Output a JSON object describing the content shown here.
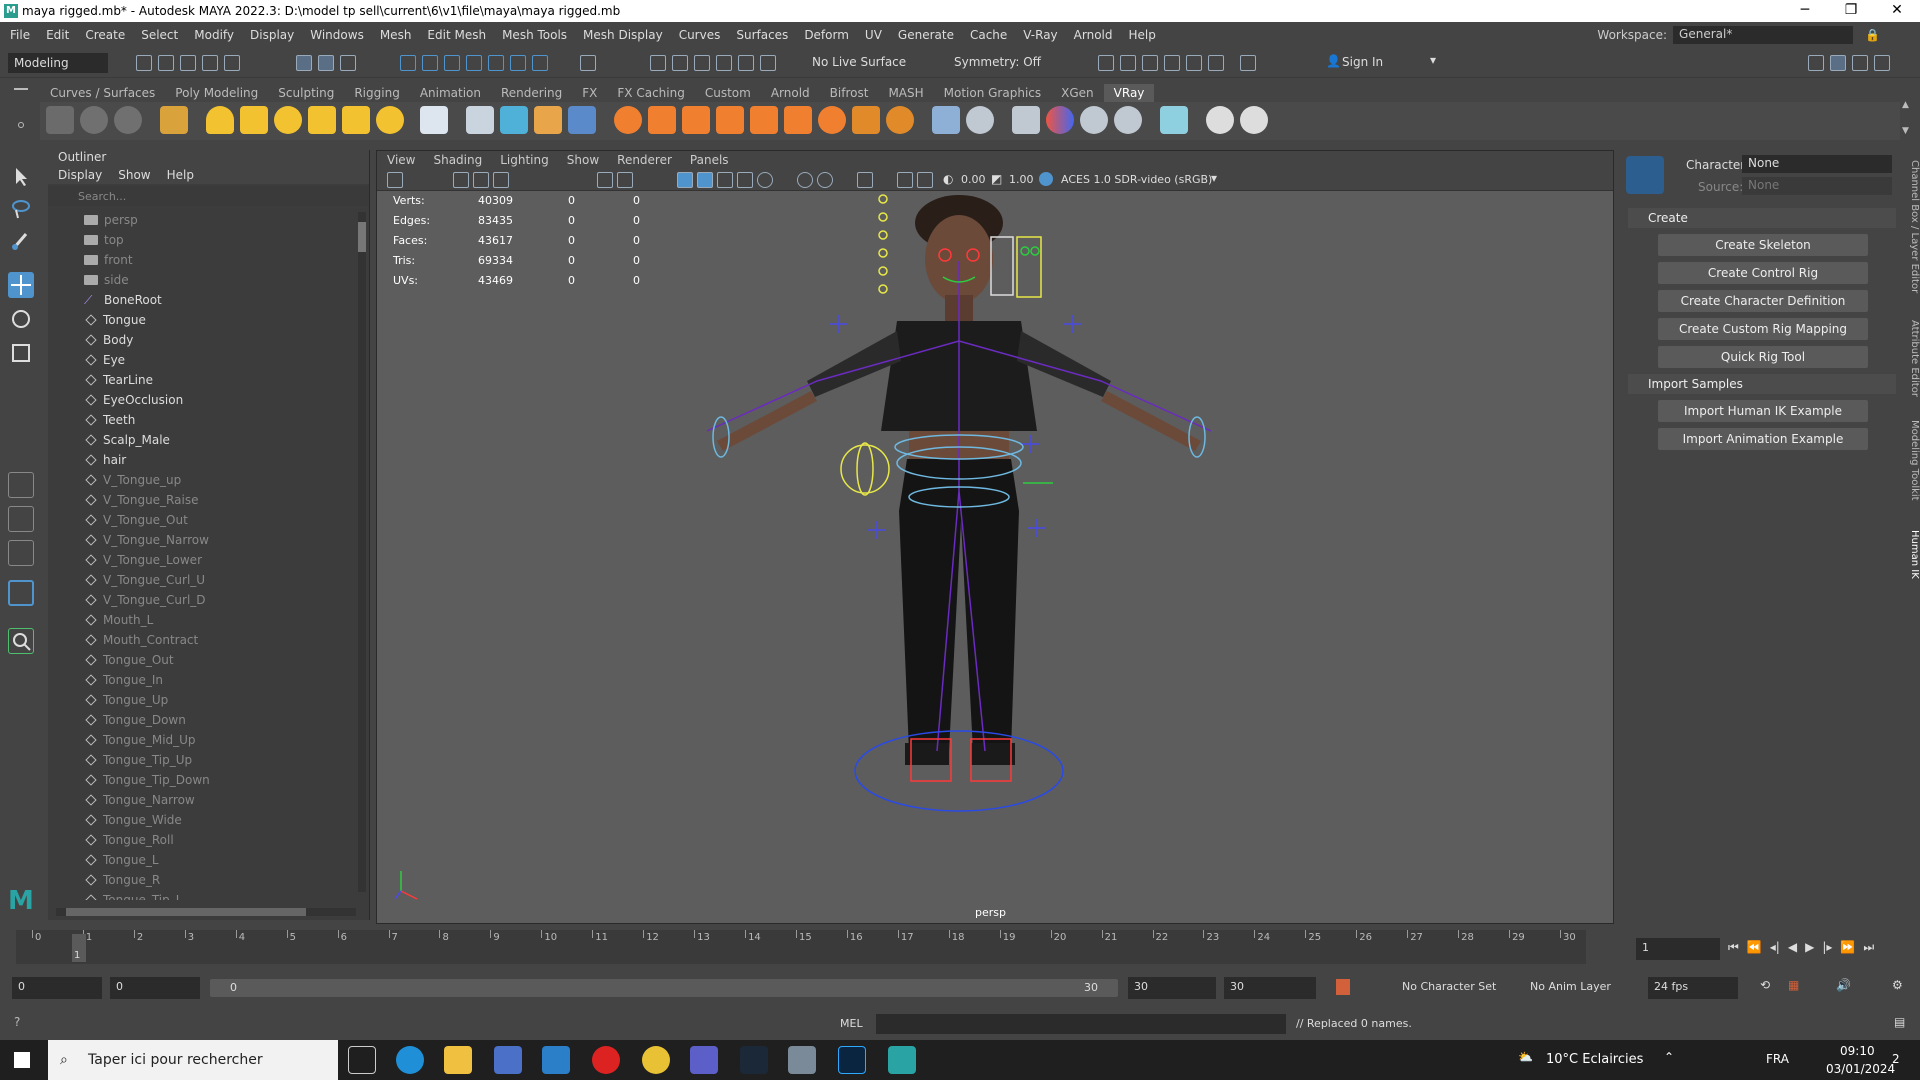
{
  "window": {
    "title": "maya rigged.mb* - Autodesk MAYA 2022.3: D:\\model tp sell\\current\\6\\v1\\file\\maya\\maya rigged.mb",
    "app_letter": "M"
  },
  "menubar": {
    "items": [
      "File",
      "Edit",
      "Create",
      "Select",
      "Modify",
      "Display",
      "Windows",
      "Mesh",
      "Edit Mesh",
      "Mesh Tools",
      "Mesh Display",
      "Curves",
      "Surfaces",
      "Deform",
      "UV",
      "Generate",
      "Cache",
      "V-Ray",
      "Arnold",
      "Help"
    ],
    "workspace_label": "Workspace:",
    "workspace_value": "General*"
  },
  "statusline": {
    "mode": "Modeling",
    "live_surface": "No Live Surface",
    "symmetry": "Symmetry: Off",
    "sign_in": "Sign In"
  },
  "shelf": {
    "tabs": [
      "Curves / Surfaces",
      "Poly Modeling",
      "Sculpting",
      "Rigging",
      "Animation",
      "Rendering",
      "FX",
      "FX Caching",
      "Custom",
      "Arnold",
      "Bifrost",
      "MASH",
      "Motion Graphics",
      "XGen",
      "VRay"
    ],
    "active_tab": "VRay"
  },
  "outliner": {
    "title": "Outliner",
    "menu": [
      "Display",
      "Show",
      "Help"
    ],
    "search_placeholder": "Search...",
    "items": [
      {
        "label": "persp",
        "kind": "camera",
        "dim": true
      },
      {
        "label": "top",
        "kind": "camera",
        "dim": true
      },
      {
        "label": "front",
        "kind": "camera",
        "dim": true
      },
      {
        "label": "side",
        "kind": "camera",
        "dim": true
      },
      {
        "label": "BoneRoot",
        "kind": "joint",
        "dim": false
      },
      {
        "label": "Tongue",
        "kind": "mesh",
        "dim": false
      },
      {
        "label": "Body",
        "kind": "mesh",
        "dim": false
      },
      {
        "label": "Eye",
        "kind": "mesh",
        "dim": false
      },
      {
        "label": "TearLine",
        "kind": "mesh",
        "dim": false
      },
      {
        "label": "EyeOcclusion",
        "kind": "mesh",
        "dim": false
      },
      {
        "label": "Teeth",
        "kind": "mesh",
        "dim": false
      },
      {
        "label": "Scalp_Male",
        "kind": "mesh",
        "dim": false
      },
      {
        "label": "hair",
        "kind": "mesh",
        "dim": false
      },
      {
        "label": "V_Tongue_up",
        "kind": "mesh",
        "dim": true
      },
      {
        "label": "V_Tongue_Raise",
        "kind": "mesh",
        "dim": true
      },
      {
        "label": "V_Tongue_Out",
        "kind": "mesh",
        "dim": true
      },
      {
        "label": "V_Tongue_Narrow",
        "kind": "mesh",
        "dim": true
      },
      {
        "label": "V_Tongue_Lower",
        "kind": "mesh",
        "dim": true
      },
      {
        "label": "V_Tongue_Curl_U",
        "kind": "mesh",
        "dim": true
      },
      {
        "label": "V_Tongue_Curl_D",
        "kind": "mesh",
        "dim": true
      },
      {
        "label": "Mouth_L",
        "kind": "mesh",
        "dim": true
      },
      {
        "label": "Mouth_Contract",
        "kind": "mesh",
        "dim": true
      },
      {
        "label": "Tongue_Out",
        "kind": "mesh",
        "dim": true
      },
      {
        "label": "Tongue_In",
        "kind": "mesh",
        "dim": true
      },
      {
        "label": "Tongue_Up",
        "kind": "mesh",
        "dim": true
      },
      {
        "label": "Tongue_Down",
        "kind": "mesh",
        "dim": true
      },
      {
        "label": "Tongue_Mid_Up",
        "kind": "mesh",
        "dim": true
      },
      {
        "label": "Tongue_Tip_Up",
        "kind": "mesh",
        "dim": true
      },
      {
        "label": "Tongue_Tip_Down",
        "kind": "mesh",
        "dim": true
      },
      {
        "label": "Tongue_Narrow",
        "kind": "mesh",
        "dim": true
      },
      {
        "label": "Tongue_Wide",
        "kind": "mesh",
        "dim": true
      },
      {
        "label": "Tongue_Roll",
        "kind": "mesh",
        "dim": true
      },
      {
        "label": "Tongue_L",
        "kind": "mesh",
        "dim": true
      },
      {
        "label": "Tongue_R",
        "kind": "mesh",
        "dim": true
      },
      {
        "label": "Tongue_Tip_L",
        "kind": "mesh",
        "dim": true
      }
    ]
  },
  "viewport": {
    "menu": [
      "View",
      "Shading",
      "Lighting",
      "Show",
      "Renderer",
      "Panels"
    ],
    "exposure": "0.00",
    "gamma": "1.00",
    "colorspace": "ACES 1.0 SDR-video (sRGB)",
    "hud": [
      {
        "label": "Verts:",
        "v": "40309",
        "a": "0",
        "b": "0"
      },
      {
        "label": "Edges:",
        "v": "83435",
        "a": "0",
        "b": "0"
      },
      {
        "label": "Faces:",
        "v": "43617",
        "a": "0",
        "b": "0"
      },
      {
        "label": "Tris:",
        "v": "69334",
        "a": "0",
        "b": "0"
      },
      {
        "label": "UVs:",
        "v": "43469",
        "a": "0",
        "b": "0"
      }
    ],
    "camera": "persp"
  },
  "humanik": {
    "character_label": "Character:",
    "character_value": "None",
    "source_label": "Source:",
    "source_value": "None",
    "create_section": "Create",
    "create_buttons": [
      "Create Skeleton",
      "Create Control Rig",
      "Create Character Definition",
      "Create Custom Rig Mapping",
      "Quick Rig Tool"
    ],
    "import_section": "Import Samples",
    "import_buttons": [
      "Import Human IK Example",
      "Import Animation Example"
    ],
    "side_tabs": [
      "Channel Box / Layer Editor",
      "Attribute Editor",
      "Modeling Toolkit",
      "Human IK"
    ]
  },
  "timeline": {
    "ticks": [
      "0",
      "1",
      "2",
      "3",
      "4",
      "5",
      "6",
      "7",
      "8",
      "9",
      "10",
      "11",
      "12",
      "13",
      "14",
      "15",
      "16",
      "17",
      "18",
      "19",
      "20",
      "21",
      "22",
      "23",
      "24",
      "25",
      "26",
      "27",
      "28",
      "29",
      "30"
    ],
    "current_frame": "1",
    "frame_field": "1"
  },
  "range": {
    "start": "0",
    "anim_start": "0",
    "slider_start": "0",
    "slider_end": "30",
    "anim_end": "30",
    "end": "30",
    "character_set": "No Character Set",
    "anim_layer": "No Anim Layer",
    "fps": "24 fps"
  },
  "cmdline": {
    "lang": "MEL",
    "result": "// Replaced 0 names."
  },
  "taskbar": {
    "search_placeholder": "Taper ici pour rechercher",
    "weather": "10°C  Eclaircies",
    "lang": "FRA",
    "time": "09:10",
    "date": "03/01/2024",
    "notif_count": "2"
  },
  "colors": {
    "bg": "#444444",
    "viewport": "#5d5d5d",
    "accent": "#4f94cd",
    "maya_teal": "#29a3a3"
  }
}
